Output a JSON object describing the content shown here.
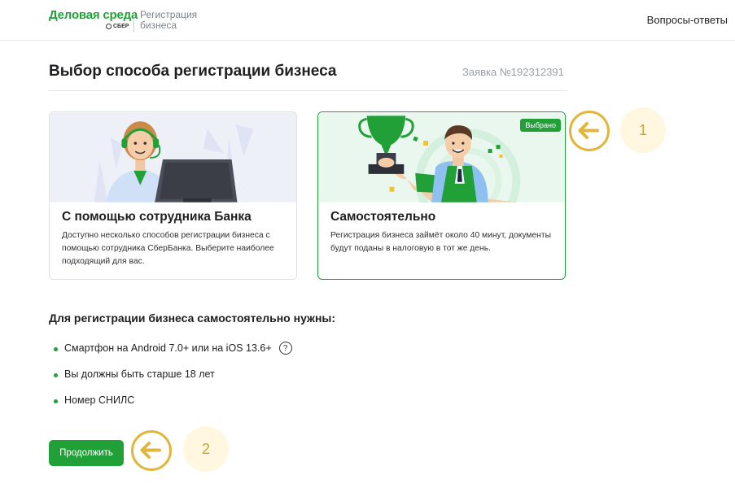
{
  "header": {
    "brand": "Деловая среда",
    "brand_sub": "СБЕР",
    "product": "Регистрация бизнеса",
    "faq_link": "Вопросы-ответы"
  },
  "page": {
    "title": "Выбор способа регистрации бизнеса",
    "request_number": "Заявка №192312391"
  },
  "options": [
    {
      "title": "С помощью сотрудника Банка",
      "text": "Доступно несколько способов регистрации бизнеса с помощью сотрудника СберБанка. Выберите наиболее подходящий для вас.",
      "selected": false
    },
    {
      "title": "Самостоятельно",
      "text": "Регистрация бизнеса займёт около 40 минут, документы будут поданы в налоговую в тот же день.",
      "selected": true,
      "badge": "Выбрано"
    }
  ],
  "requirements": {
    "title": "Для регистрации бизнеса самостоятельно нужны:",
    "items": [
      "Смартфон на Android 7.0+ или на iOS 13.6+",
      "Вы должны быть старше 18 лет",
      "Номер СНИЛС"
    ],
    "help_glyph": "?"
  },
  "actions": {
    "continue_label": "Продолжить"
  },
  "annotations": {
    "marker_1": "1",
    "marker_2": "2"
  },
  "colors": {
    "brand_green": "#21a038",
    "annotation_gold": "#e0b63c"
  }
}
